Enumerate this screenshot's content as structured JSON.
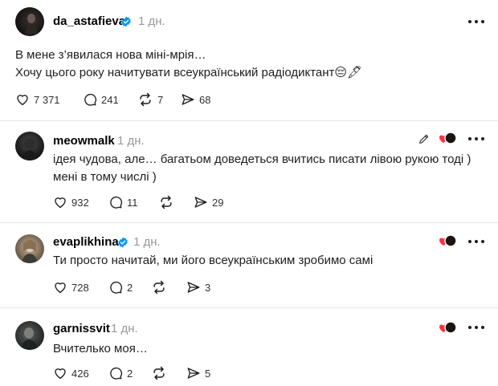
{
  "posts": [
    {
      "username": "da_astafieva",
      "verified": true,
      "time": "1 дн.",
      "text_lines": [
        "В мене з’явилася нова міні-мрія…",
        "Хочу цього року начитувати всеукраїнський радіодиктант😔🖋"
      ],
      "stats": {
        "likes": "7 371",
        "replies": "241",
        "reposts": "7",
        "shares": "68"
      }
    },
    {
      "username": "meowmalk",
      "verified": false,
      "time": "1 дн.",
      "text_lines": [
        "ідея чудова, але… багатьом доведеться вчитись писати лівою рукою тоді )",
        "мені в тому числі )"
      ],
      "stats": {
        "likes": "932",
        "replies": "11",
        "reposts": "",
        "shares": "29"
      }
    },
    {
      "username": "evaplikhina",
      "verified": true,
      "time": "1 дн.",
      "text_lines": [
        "Ти просто начитай, ми його всеукраїнським зробимо самі"
      ],
      "stats": {
        "likes": "728",
        "replies": "2",
        "reposts": "",
        "shares": "3"
      }
    },
    {
      "username": "garnissvit",
      "verified": false,
      "time": "1 дн.",
      "text_lines": [
        "Вчителько моя…"
      ],
      "stats": {
        "likes": "426",
        "replies": "2",
        "reposts": "",
        "shares": "5"
      }
    }
  ],
  "colors": {
    "text": "#1e1e1e",
    "muted": "#999999",
    "verified": "#0095f6",
    "heart": "#ff3040",
    "divider": "#e6e6e6"
  }
}
